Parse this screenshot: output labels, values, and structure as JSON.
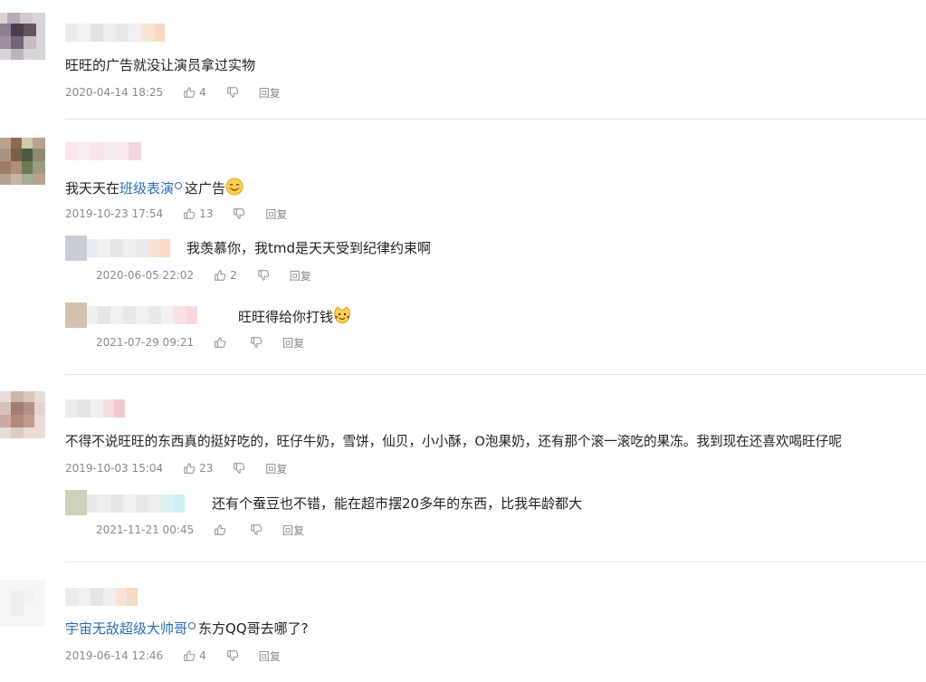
{
  "comments": [
    {
      "content": "旺旺的广告就没让演员拿过实物",
      "time": "2020-04-14 18:25",
      "likes": "4",
      "reply_label": "回复"
    },
    {
      "content_prefix": "我天天在",
      "content_link": "班级表演",
      "content_suffix": "这广告",
      "emoji": "smile-blush-emoji",
      "time": "2019-10-23 17:54",
      "likes": "13",
      "reply_label": "回复",
      "replies": [
        {
          "content": "我羡慕你，我tmd是天天受到纪律约束啊",
          "time": "2020-06-05 22:02",
          "likes": "2",
          "reply_label": "回复"
        },
        {
          "content": "旺旺得给你打钱",
          "emoji": "cat-emoji",
          "time": "2021-07-29 09:21",
          "likes": "",
          "reply_label": "回复"
        }
      ]
    },
    {
      "content": "不得不说旺旺的东西真的挺好吃的，旺仔牛奶，雪饼，仙贝，小小酥，O泡果奶，还有那个滚一滚吃的果冻。我到现在还喜欢喝旺仔呢",
      "time": "2019-10-03 15:04",
      "likes": "23",
      "reply_label": "回复",
      "replies": [
        {
          "content": "还有个蚕豆也不错，能在超市摆20多年的东西，比我年龄都大",
          "time": "2021-11-21 00:45",
          "likes": "",
          "reply_label": "回复"
        }
      ]
    },
    {
      "content_link": "宇宙无敌超级大帅哥",
      "content_suffix": "东方QQ哥去哪了?",
      "time": "2019-06-14 12:46",
      "likes": "4",
      "reply_label": "回复"
    }
  ],
  "colors": {
    "link": "#2a6fb0",
    "meta": "#8a8a8a",
    "divider": "#e6e6e6"
  }
}
